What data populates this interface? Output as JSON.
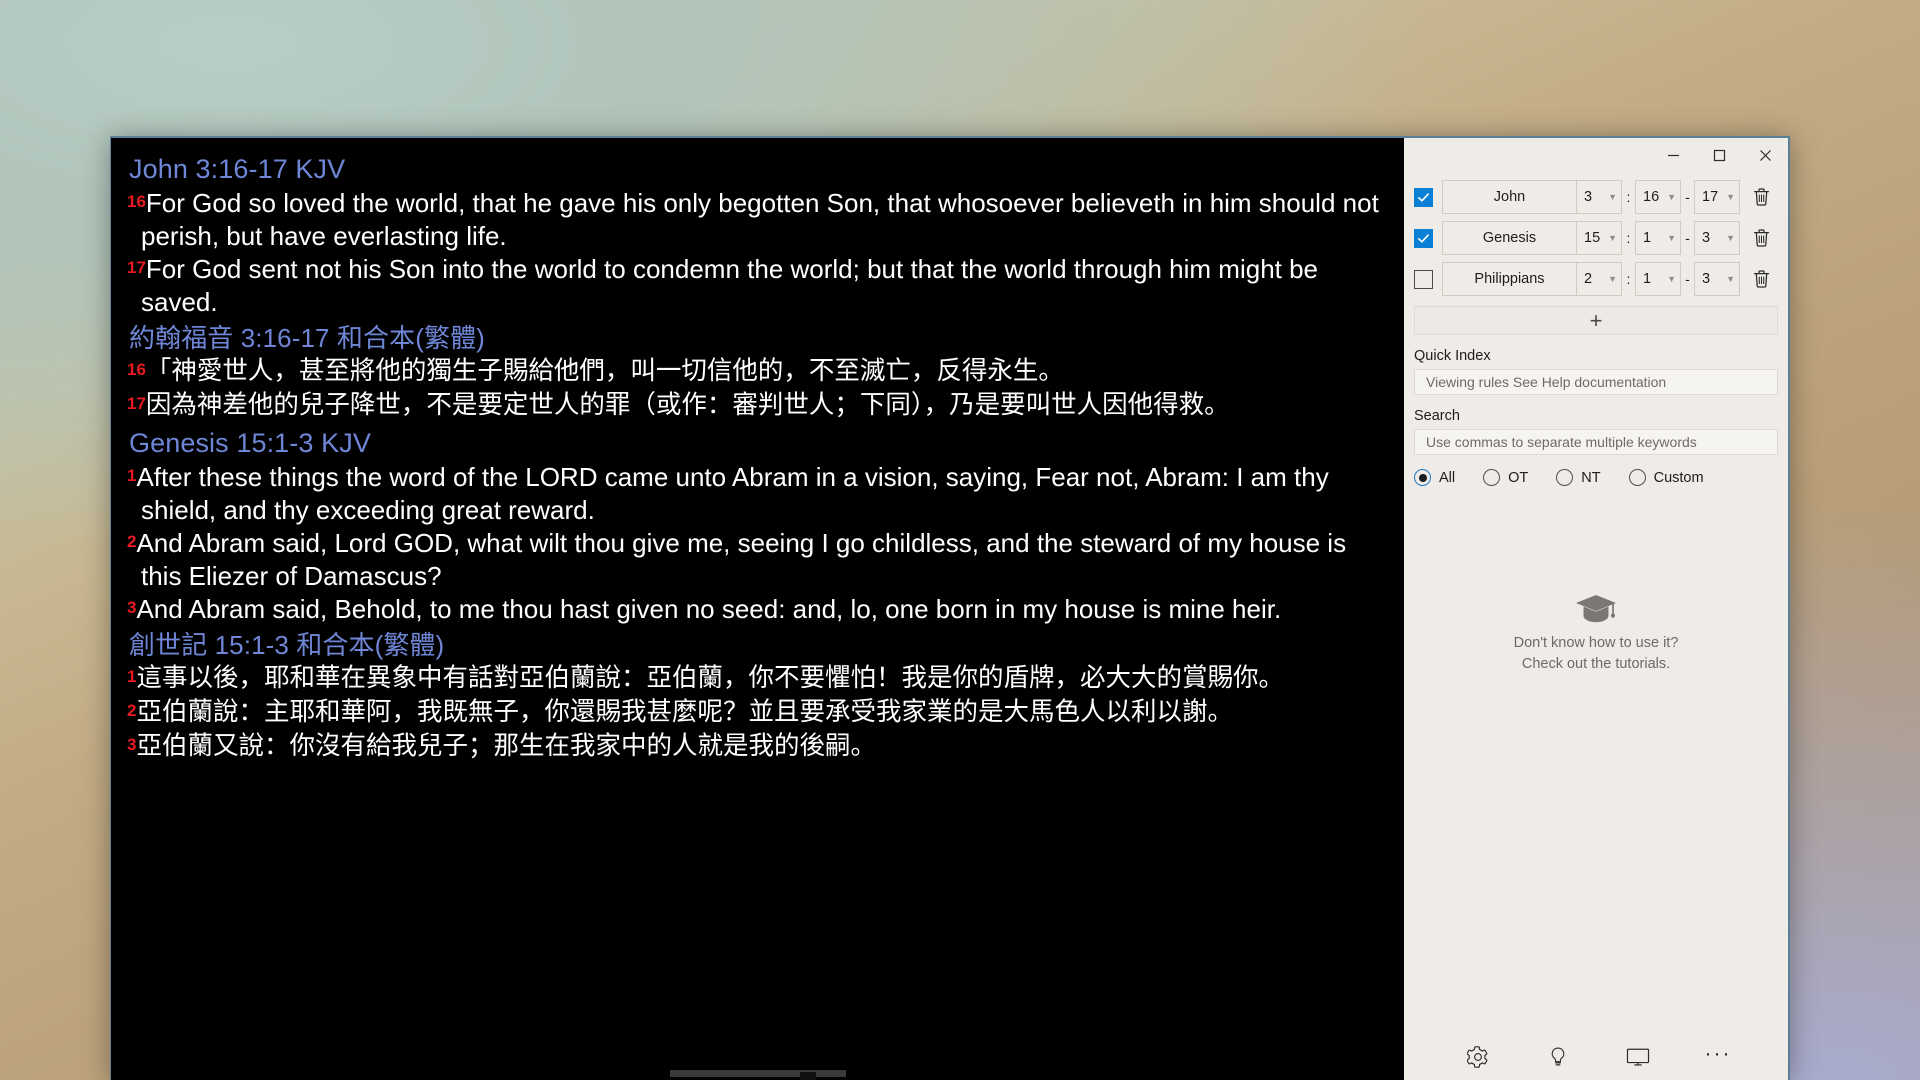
{
  "window": {
    "controls": {
      "minimize": "—",
      "maximize": "□",
      "close": "✕"
    }
  },
  "reading_pane": {
    "passages": [
      {
        "title": "John 3:16-17 KJV",
        "language": "en",
        "verses": [
          {
            "num": "16",
            "text": "For God so loved the world, that he gave his only begotten Son, that whosoever believeth in him should not perish, but have everlasting life."
          },
          {
            "num": "17",
            "text": "For God sent not his Son into the world to condemn the world; but that the world through him might be saved."
          }
        ]
      },
      {
        "title": "約翰福音 3:16-17 和合本(繁體)",
        "language": "zh",
        "verses": [
          {
            "num": "16",
            "text": "「神愛世人，甚至將他的獨生子賜給他們，叫一切信他的，不至滅亡，反得永生。"
          },
          {
            "num": "17",
            "text": "因為神差他的兒子降世，不是要定世人的罪（或作：審判世人；下同），乃是要叫世人因他得救。"
          }
        ]
      },
      {
        "title": "Genesis 15:1-3 KJV",
        "language": "en",
        "verses": [
          {
            "num": "1",
            "text": "After these things the word of the LORD came unto Abram in a vision, saying, Fear not, Abram: I am thy shield, and thy exceeding great reward."
          },
          {
            "num": "2",
            "text": "And Abram said, Lord GOD, what wilt thou give me, seeing I go childless, and the steward of my house is this Eliezer of Damascus?"
          },
          {
            "num": "3",
            "text": "And Abram said, Behold, to me thou hast given no seed: and, lo, one born in my house is mine heir."
          }
        ]
      },
      {
        "title": "創世記 15:1-3 和合本(繁體)",
        "language": "zh",
        "verses": [
          {
            "num": "1",
            "text": "這事以後，耶和華在異象中有話對亞伯蘭說：亞伯蘭，你不要懼怕！我是你的盾牌，必大大的賞賜你。"
          },
          {
            "num": "2",
            "text": "亞伯蘭說：主耶和華阿，我既無子，你還賜我甚麼呢？並且要承受我家業的是大馬色人以利以謝。"
          },
          {
            "num": "3",
            "text": "亞伯蘭又說：你沒有給我兒子；那生在我家中的人就是我的後嗣。"
          }
        ]
      }
    ]
  },
  "sidebar": {
    "references": [
      {
        "checked": true,
        "book": "John",
        "chapter": "3",
        "verse_from": "16",
        "verse_to": "17",
        "separator": ":",
        "range_dash": "-"
      },
      {
        "checked": true,
        "book": "Genesis",
        "chapter": "15",
        "verse_from": "1",
        "verse_to": "3",
        "separator": ":",
        "range_dash": "-"
      },
      {
        "checked": false,
        "book": "Philippians",
        "chapter": "2",
        "verse_from": "1",
        "verse_to": "3",
        "separator": ":",
        "range_dash": "-"
      }
    ],
    "add_row_label": "+",
    "quick_index": {
      "label": "Quick Index",
      "value": "",
      "placeholder": "Viewing rules See Help documentation"
    },
    "search": {
      "label": "Search",
      "value": "",
      "placeholder": "Use commas to separate multiple keywords"
    },
    "scope_options": [
      {
        "label": "All",
        "selected": true
      },
      {
        "label": "OT",
        "selected": false
      },
      {
        "label": "NT",
        "selected": false
      },
      {
        "label": "Custom",
        "selected": false
      }
    ],
    "tutorial": {
      "line1": "Don't know how to use it?",
      "line2": "Check out the tutorials."
    },
    "bottom_bar": {
      "settings": "gear-icon",
      "tips": "lightbulb-icon",
      "display": "monitor-icon",
      "more": "···"
    }
  },
  "colors": {
    "verse_text": "#ffffff",
    "passage_title": "#6f86d6",
    "verse_number": "#e8191f",
    "reading_bg": "#000000",
    "sidebar_bg": "#efece8",
    "accent_checkbox": "#0a7fd6",
    "accent_radio": "#1878c8",
    "window_border": "#5b7f96"
  }
}
